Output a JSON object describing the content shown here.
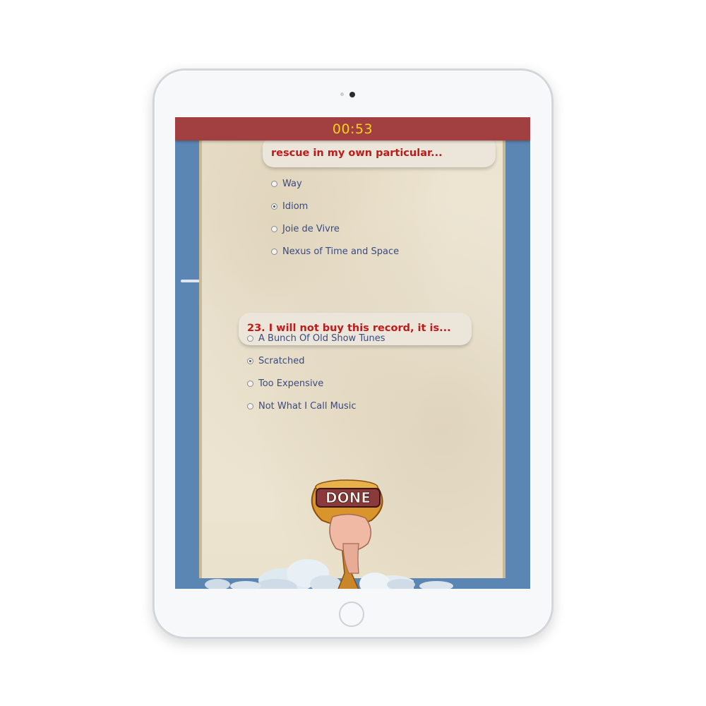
{
  "timer": {
    "value": "00:53"
  },
  "questions": [
    {
      "text": "rescue in my own particular...",
      "options": [
        {
          "label": "Way",
          "selected": false
        },
        {
          "label": "Idiom",
          "selected": true
        },
        {
          "label": "Joie de Vivre",
          "selected": false
        },
        {
          "label": "Nexus of Time and Space",
          "selected": false
        }
      ]
    },
    {
      "text": "23. I will not buy this record, it is...",
      "options": [
        {
          "label": "A Bunch Of Old Show Tunes",
          "selected": false
        },
        {
          "label": "Scratched",
          "selected": true
        },
        {
          "label": "Too Expensive",
          "selected": false
        },
        {
          "label": "Not What I Call Music",
          "selected": false
        }
      ]
    }
  ],
  "done_image": {
    "text": "DONE"
  },
  "colors": {
    "timer_bar": "#a23f40",
    "timer_text": "#ffd21c",
    "screen_background": "#5b86b3",
    "question_text": "#c01a1a",
    "option_text": "#3b4a80"
  }
}
